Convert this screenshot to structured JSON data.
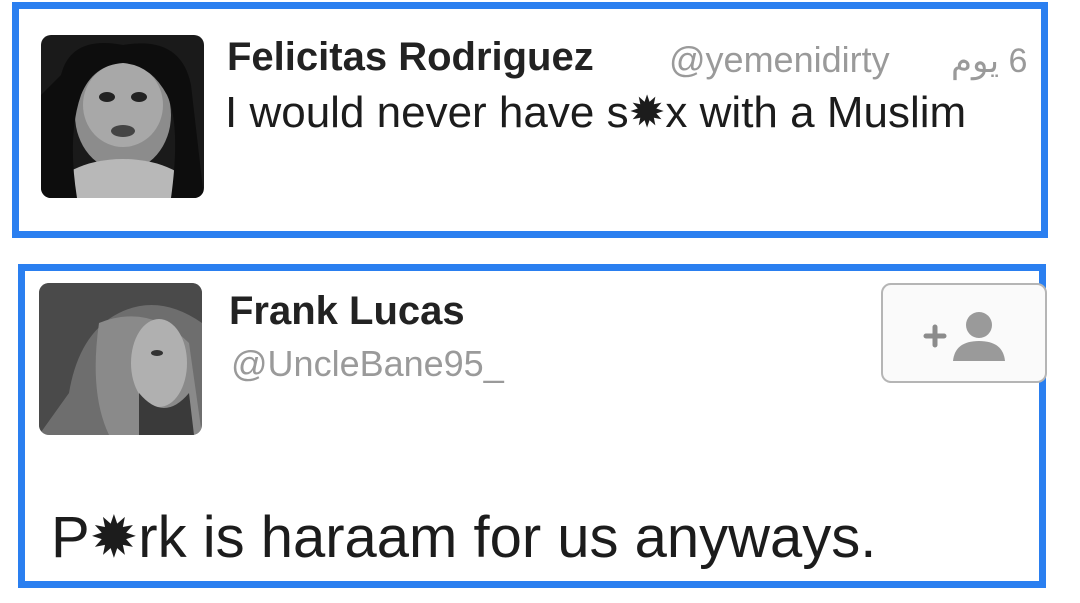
{
  "tweets": [
    {
      "author_name": "Felicitas Rodriguez",
      "handle": "@yemenidirty",
      "timestamp": "6 يوم",
      "text": "I would never have s✹x with a Muslim"
    },
    {
      "author_name": "Frank Lucas",
      "handle": "@UncleBane95_",
      "text": "P✹rk is haraam for us anyways.",
      "follow_icon": "add-user-icon"
    }
  ],
  "colors": {
    "border": "#2a7ff0",
    "name": "#222222",
    "handle": "#9a9a9a"
  }
}
